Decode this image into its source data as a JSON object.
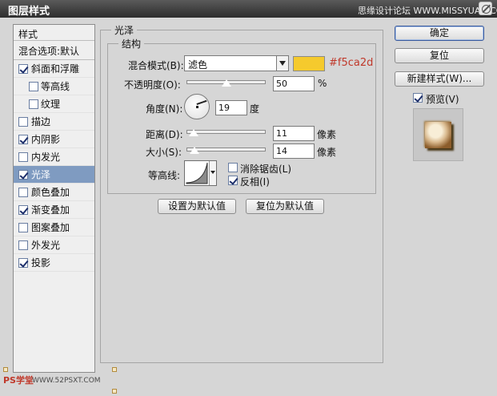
{
  "window": {
    "title": "图层样式",
    "watermark": "思缘设计论坛 WWW.MISSYUAN.COM"
  },
  "style_list": {
    "header": "样式",
    "blend_options": "混合选项:默认",
    "items": [
      {
        "label": "斜面和浮雕",
        "checked": true,
        "indent": false,
        "selected": false
      },
      {
        "label": "等高线",
        "checked": false,
        "indent": true,
        "selected": false
      },
      {
        "label": "纹理",
        "checked": false,
        "indent": true,
        "selected": false
      },
      {
        "label": "描边",
        "checked": false,
        "indent": false,
        "selected": false
      },
      {
        "label": "内阴影",
        "checked": true,
        "indent": false,
        "selected": false
      },
      {
        "label": "内发光",
        "checked": false,
        "indent": false,
        "selected": false
      },
      {
        "label": "光泽",
        "checked": true,
        "indent": false,
        "selected": true
      },
      {
        "label": "颜色叠加",
        "checked": false,
        "indent": false,
        "selected": false
      },
      {
        "label": "渐变叠加",
        "checked": true,
        "indent": false,
        "selected": false
      },
      {
        "label": "图案叠加",
        "checked": false,
        "indent": false,
        "selected": false
      },
      {
        "label": "外发光",
        "checked": false,
        "indent": false,
        "selected": false
      },
      {
        "label": "投影",
        "checked": true,
        "indent": false,
        "selected": false
      }
    ]
  },
  "satin": {
    "group_title": "光泽",
    "structure_title": "结构",
    "blend_mode_label": "混合模式(B):",
    "blend_mode_value": "滤色",
    "color_hex": "#f5ca2d",
    "color_label": "#f5ca2d",
    "opacity_label": "不透明度(O):",
    "opacity_value": "50",
    "opacity_unit": "%",
    "angle_label": "角度(N):",
    "angle_value": "19",
    "angle_unit": "度",
    "distance_label": "距离(D):",
    "distance_value": "11",
    "distance_unit": "像素",
    "size_label": "大小(S):",
    "size_value": "14",
    "size_unit": "像素",
    "contour_label": "等高线:",
    "anti_alias_label": "消除锯齿(L)",
    "anti_alias_checked": false,
    "invert_label": "反相(I)",
    "invert_checked": true,
    "set_default": "设置为默认值",
    "reset_default": "复位为默认值"
  },
  "actions": {
    "ok": "确定",
    "reset": "复位",
    "new_style": "新建样式(W)...",
    "preview_label": "预览(V)",
    "preview_checked": true
  },
  "footer": {
    "logo": "PS学堂",
    "site": "WWW.52PSXT.COM"
  }
}
